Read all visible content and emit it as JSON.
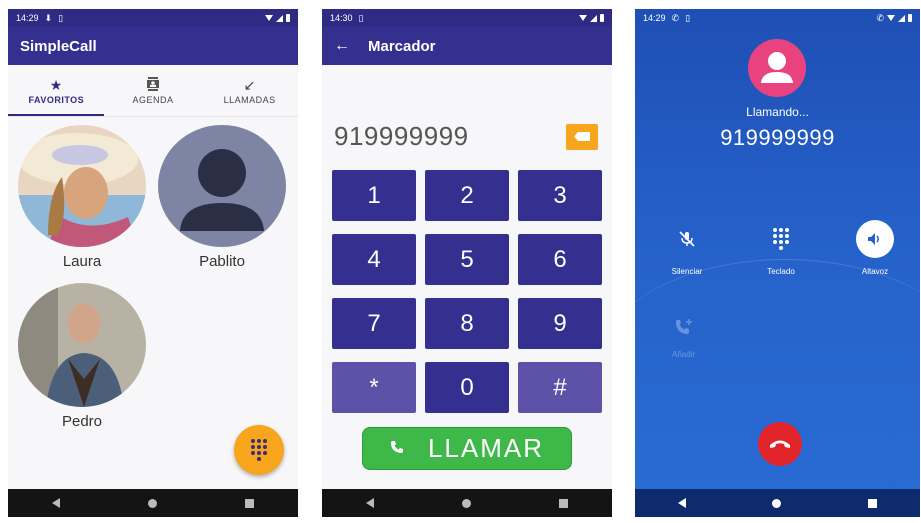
{
  "screen1": {
    "status": {
      "time": "14:29",
      "icons": [
        "download-icon",
        "sim-icon"
      ]
    },
    "title": "SimpleCall",
    "tabs": [
      {
        "label": "FAVORITOS",
        "icon": "star-icon",
        "active": true
      },
      {
        "label": "AGENDA",
        "icon": "contacts-icon",
        "active": false
      },
      {
        "label": "LLAMADAS",
        "icon": "call-received-icon",
        "active": false
      }
    ],
    "favorites": [
      {
        "name": "Laura"
      },
      {
        "name": "Pablito"
      },
      {
        "name": "Pedro"
      }
    ],
    "fab_icon": "dialpad-icon"
  },
  "screen2": {
    "status": {
      "time": "14:30"
    },
    "title": "Marcador",
    "number": "919999999",
    "keys": [
      "1",
      "2",
      "3",
      "4",
      "5",
      "6",
      "7",
      "8",
      "9",
      "*",
      "0",
      "#"
    ],
    "call_label": "LLAMAR"
  },
  "screen3": {
    "status": {
      "time": "14:29"
    },
    "calling_text": "Llamando...",
    "number": "919999999",
    "controls": [
      {
        "label": "Silenciar",
        "icon": "mic-off-icon"
      },
      {
        "label": "Teclado",
        "icon": "dialpad-icon"
      },
      {
        "label": "Altavoz",
        "icon": "speaker-icon"
      }
    ],
    "merge_label": "Añadir"
  },
  "colors": {
    "primary": "#35308f",
    "accent": "#f6a51c",
    "call_green": "#3fb84a",
    "hangup_red": "#e0242a",
    "avatar_pink": "#e8437f"
  }
}
